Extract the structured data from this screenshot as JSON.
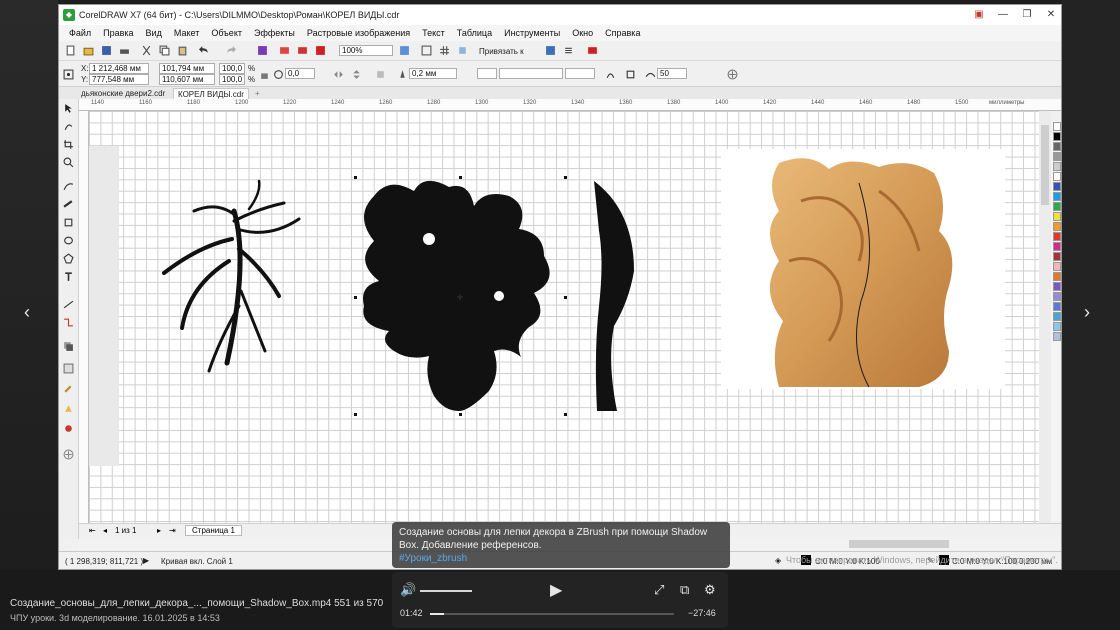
{
  "window": {
    "title": "CorelDRAW X7 (64 бит) - C:\\Users\\DILMMO\\Desktop\\Роман\\КОРЕЛ ВИДЫ.cdr"
  },
  "menu": [
    "Файл",
    "Правка",
    "Вид",
    "Макет",
    "Объект",
    "Эффекты",
    "Растровые изображения",
    "Текст",
    "Таблица",
    "Инструменты",
    "Окно",
    "Справка"
  ],
  "toolbar": {
    "zoom": "100%",
    "snap_label": "Привязать к"
  },
  "property_bar": {
    "x_label": "X:",
    "y_label": "Y:",
    "x": "1 212,468 мм",
    "y": "777,548 мм",
    "width": "101,794 мм",
    "height": "110,607 мм",
    "scale_w": "100,0",
    "scale_h": "100,0",
    "percent": "%",
    "rotation": "0,0",
    "outline": "0,2 мм",
    "smoothing": "50"
  },
  "tabs": [
    "дьяконские двери2.cdr",
    "КОРЕЛ ВИДЫ.cdr"
  ],
  "ruler": {
    "ticks": [
      "1140",
      "1160",
      "1180",
      "1200",
      "1220",
      "1240",
      "1260",
      "1280",
      "1300",
      "1320",
      "1340",
      "1360",
      "1380",
      "1400",
      "1420",
      "1440",
      "1460",
      "1480",
      "1500"
    ],
    "unit": "миллиметры"
  },
  "page_nav": {
    "count": "1 из 1",
    "page_tab": "Страница 1"
  },
  "status": {
    "coords": "( 1 298,319; 811,721 )",
    "object": "Кривая вкл. Слой 1",
    "fill": "C:0 M:0 Y:0 K:100",
    "outline": "C:0 M:0 Y:0 K:100  0,200 мм"
  },
  "tooltip": {
    "text": "Создание основы  для лепки декора в ZBrush при помощи Shadow Box. Добавление референсов.",
    "tag": "#Уроки_zbrush"
  },
  "player": {
    "current_time": "01:42",
    "remaining_time": "−27:46",
    "progress_fraction": 0.058
  },
  "video": {
    "title": "Создание_основы_для_лепки_декора_..._помощи_Shadow_Box.mp4 551 из 570",
    "subtitle": "ЧПУ уроки. 3d моделирование.   16.01.2025 в 14:53"
  },
  "watermark": "Чтобы активировать Windows, перейдите в раздел \"Параметры\"."
}
